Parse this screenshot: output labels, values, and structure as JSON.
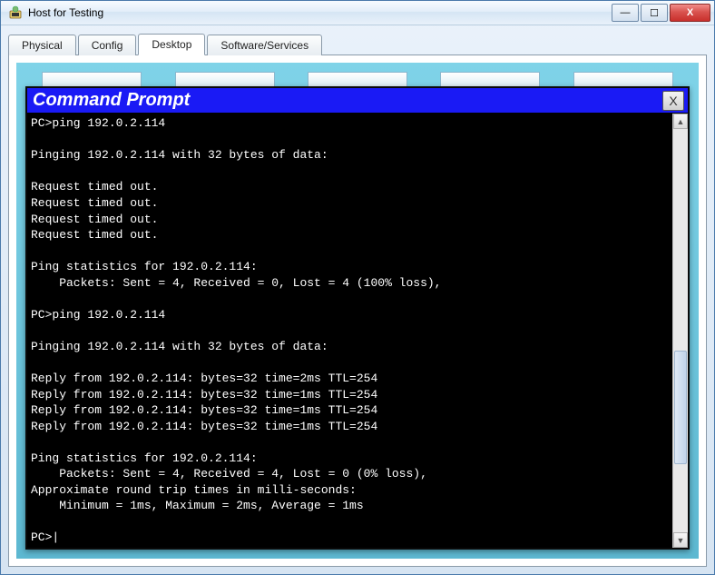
{
  "window": {
    "title": "Host for Testing"
  },
  "tabs": [
    {
      "label": "Physical"
    },
    {
      "label": "Config"
    },
    {
      "label": "Desktop"
    },
    {
      "label": "Software/Services"
    }
  ],
  "cmd": {
    "title": "Command Prompt",
    "close": "X",
    "lines": {
      "l0": "PC>ping 192.0.2.114",
      "l1": "",
      "l2": "Pinging 192.0.2.114 with 32 bytes of data:",
      "l3": "",
      "l4": "Request timed out.",
      "l5": "Request timed out.",
      "l6": "Request timed out.",
      "l7": "Request timed out.",
      "l8": "",
      "l9": "Ping statistics for 192.0.2.114:",
      "l10": "    Packets: Sent = 4, Received = 0, Lost = 4 (100% loss),",
      "l11": "",
      "l12": "PC>ping 192.0.2.114",
      "l13": "",
      "l14": "Pinging 192.0.2.114 with 32 bytes of data:",
      "l15": "",
      "l16": "Reply from 192.0.2.114: bytes=32 time=2ms TTL=254",
      "l17": "Reply from 192.0.2.114: bytes=32 time=1ms TTL=254",
      "l18": "Reply from 192.0.2.114: bytes=32 time=1ms TTL=254",
      "l19": "Reply from 192.0.2.114: bytes=32 time=1ms TTL=254",
      "l20": "",
      "l21": "Ping statistics for 192.0.2.114:",
      "l22": "    Packets: Sent = 4, Received = 4, Lost = 0 (0% loss),",
      "l23": "Approximate round trip times in milli-seconds:",
      "l24": "    Minimum = 1ms, Maximum = 2ms, Average = 1ms",
      "l25": "",
      "l26": "PC>"
    }
  },
  "winbtns": {
    "min": "—",
    "max": "☐",
    "close": "X"
  },
  "scroll": {
    "up": "▲",
    "down": "▼"
  }
}
